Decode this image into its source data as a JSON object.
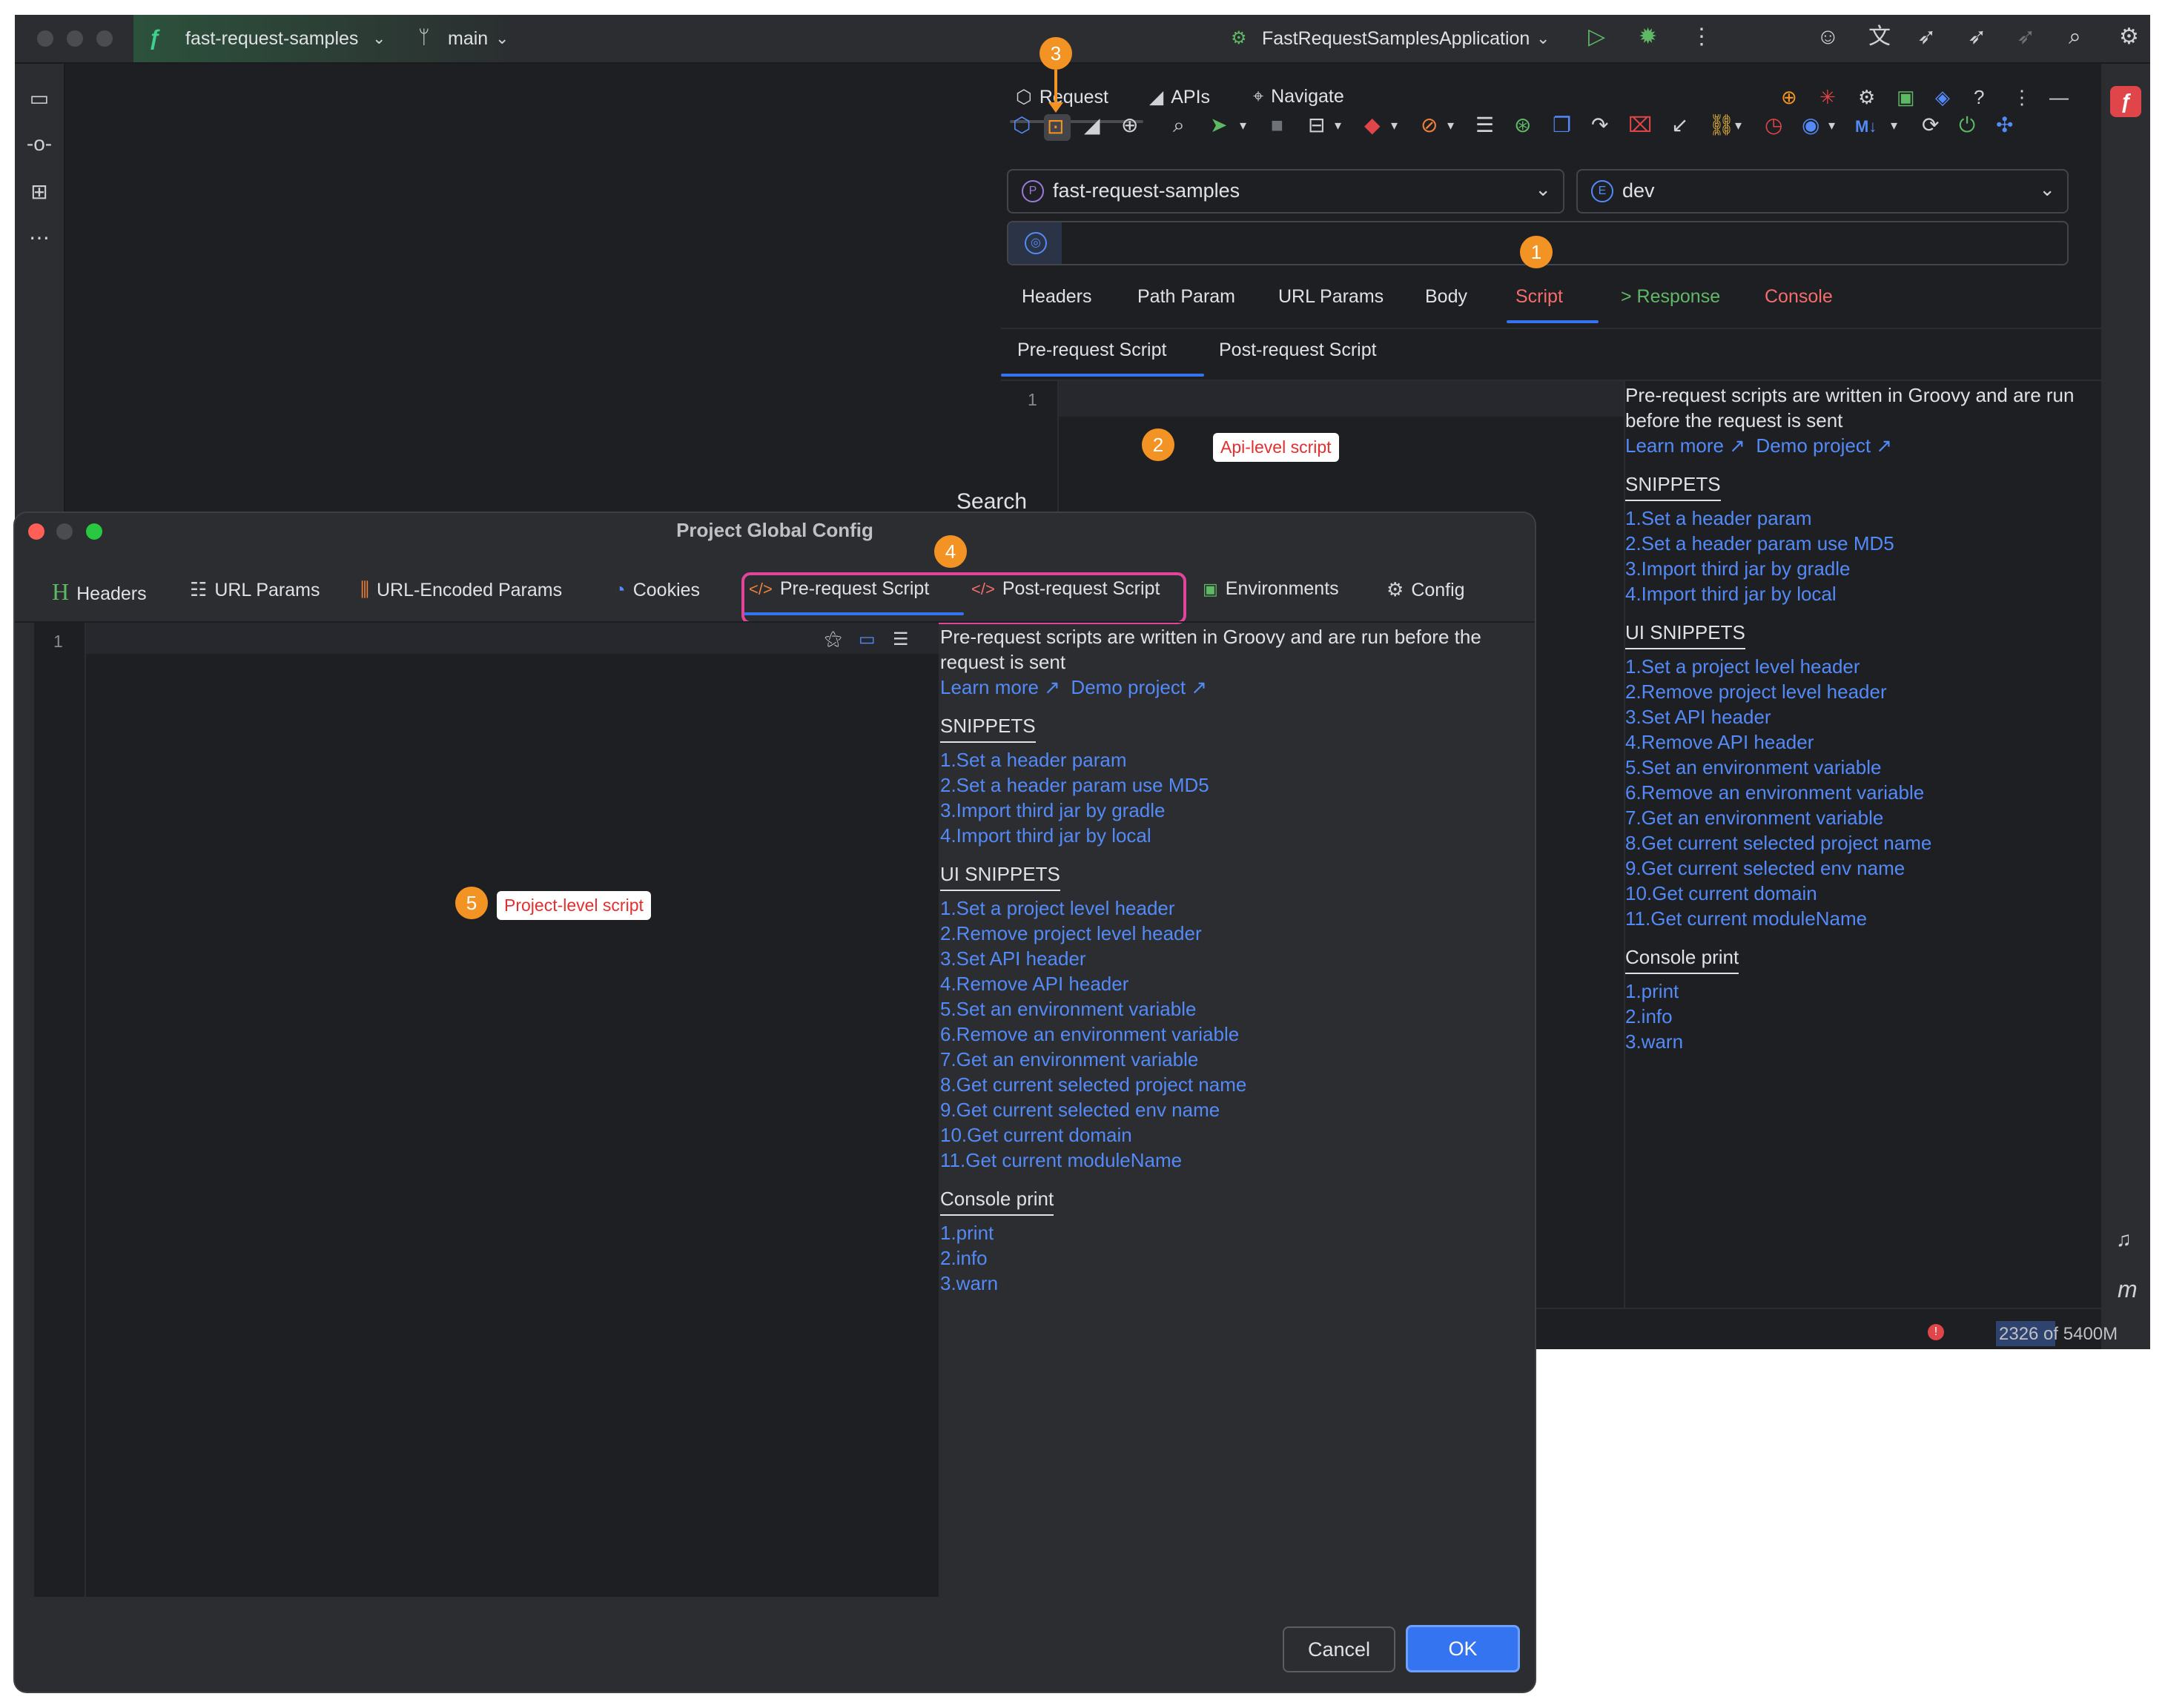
{
  "titlebar": {
    "project": "fast-request-samples",
    "branch": "main",
    "run_config": "FastRequestSamplesApplication"
  },
  "panel": {
    "tabs": [
      "Request",
      "APIs",
      "Navigate"
    ],
    "project_select": "fast-request-samples",
    "env_select": "dev",
    "req_tabs": [
      {
        "label": "Headers"
      },
      {
        "label": "Path Param"
      },
      {
        "label": "URL Params"
      },
      {
        "label": "Body"
      },
      {
        "label": "Script"
      },
      {
        "label": "> Response"
      },
      {
        "label": "Console"
      }
    ],
    "script_tabs": [
      "Pre-request Script",
      "Post-request Script"
    ],
    "line1": "1",
    "search_text": "Search"
  },
  "doc": {
    "desc": "Pre-request scripts are written in Groovy and are run before the request is sent",
    "learn_more": "Learn more ↗",
    "demo_project": "Demo project ↗",
    "snippets_head": "SNIPPETS",
    "snippets": [
      "1.Set a header param",
      "2.Set a header param use MD5",
      "3.Import third jar by gradle",
      "4.Import third jar by local"
    ],
    "ui_snippets_head": "UI SNIPPETS",
    "ui_snippets": [
      "1.Set a project level header",
      "2.Remove project level header",
      "3.Set API header",
      "4.Remove API header",
      "5.Set an environment variable",
      "6.Remove an environment variable",
      "7.Get an environment variable",
      "8.Get current selected project name",
      "9.Get current selected env name",
      "10.Get current domain",
      "11.Get current moduleName"
    ],
    "console_head": "Console print",
    "console": [
      "1.print",
      "2.info",
      "3.warn"
    ]
  },
  "annotations": {
    "b1": "1",
    "b2": "2",
    "b3": "3",
    "b4": "4",
    "b5": "5",
    "api_label": "Api-level script",
    "project_label": "Project-level script"
  },
  "dialog": {
    "title": "Project Global Config",
    "tabs": [
      "Headers",
      "URL Params",
      "URL-Encoded Params",
      "Cookies",
      "Pre-request Script",
      "Post-request Script",
      "Environments",
      "Config"
    ],
    "line1": "1",
    "cancel": "Cancel",
    "ok": "OK"
  },
  "status": {
    "memory": "2326 of 5400M"
  },
  "colors": {
    "accent": "#3574f0",
    "script_tab": "#f56c6c",
    "response_tab": "#5fb865",
    "console_tab": "#f56c6c",
    "link": "#548af7",
    "badge": "#f39324",
    "highlight_box": "#e0459a"
  }
}
